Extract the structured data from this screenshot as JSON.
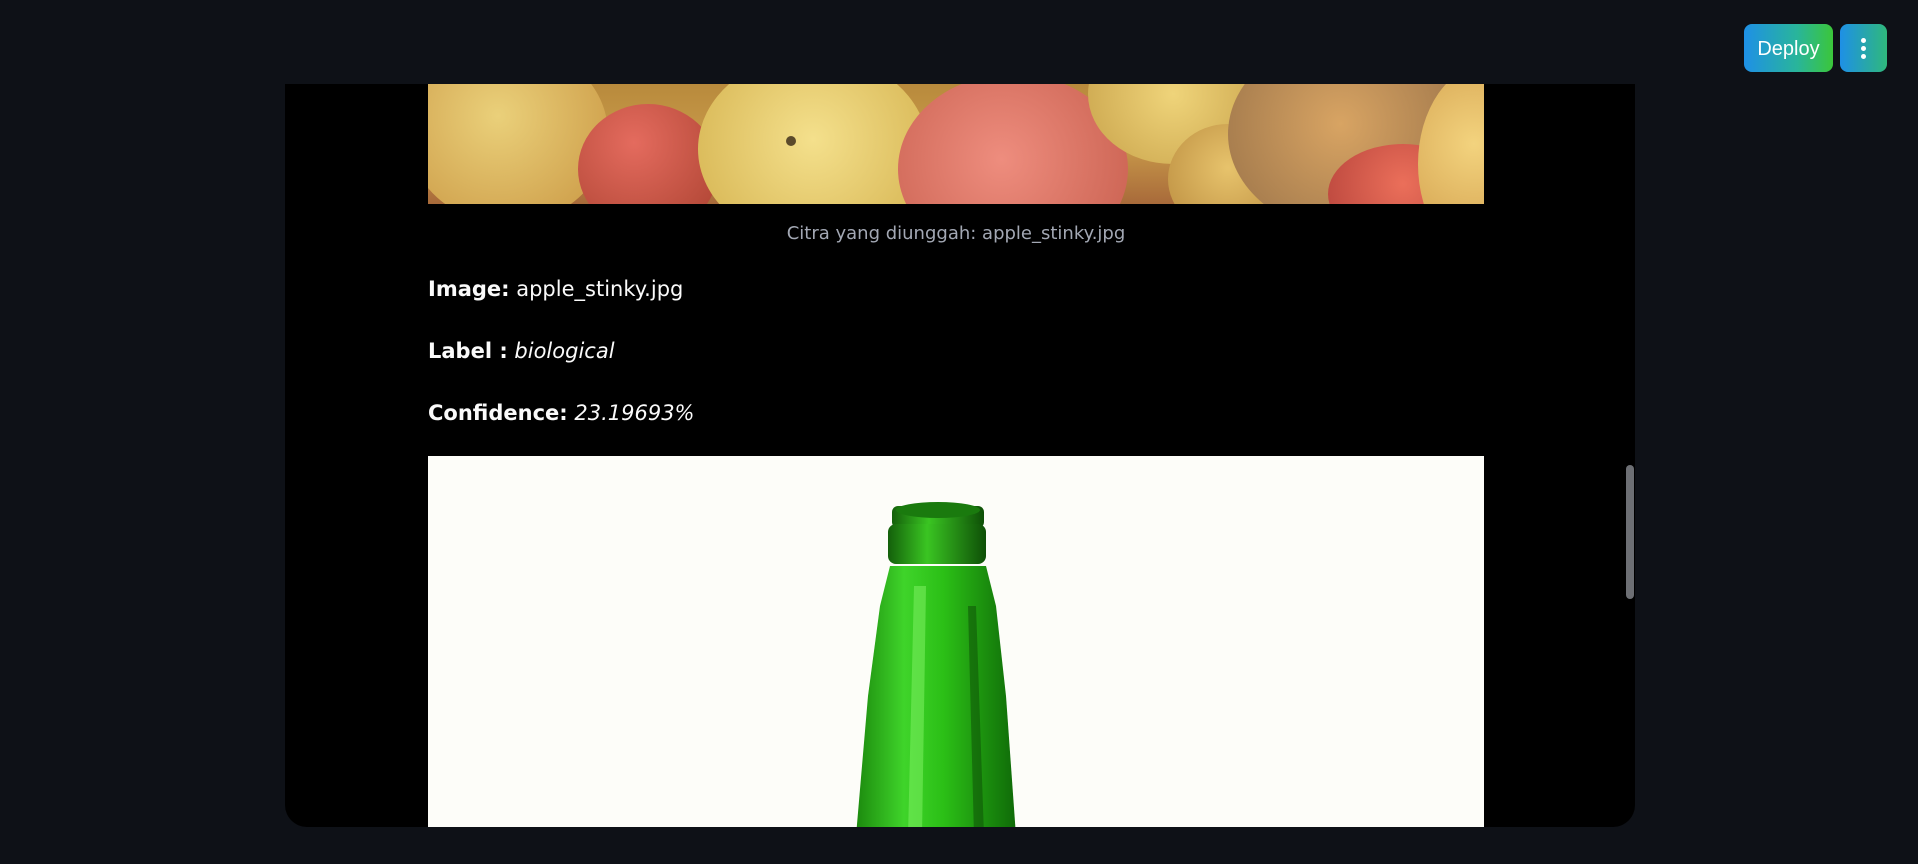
{
  "header": {
    "deploy_label": "Deploy",
    "menu_icon": "vertical-ellipsis-icon"
  },
  "result": {
    "caption": "Citra yang diunggah: apple_stinky.jpg",
    "image_label": "Image:",
    "image_value": "apple_stinky.jpg",
    "label_label": "Label :",
    "label_value": "biological",
    "confidence_label": "Confidence:",
    "confidence_value": "23.19693%"
  },
  "colors": {
    "app_background": "#0e1117",
    "panel_background": "#000000",
    "deploy_gradient_start": "#1e90e6",
    "deploy_gradient_end": "#3bc63a",
    "bottle_green": "#2fbf1a"
  }
}
